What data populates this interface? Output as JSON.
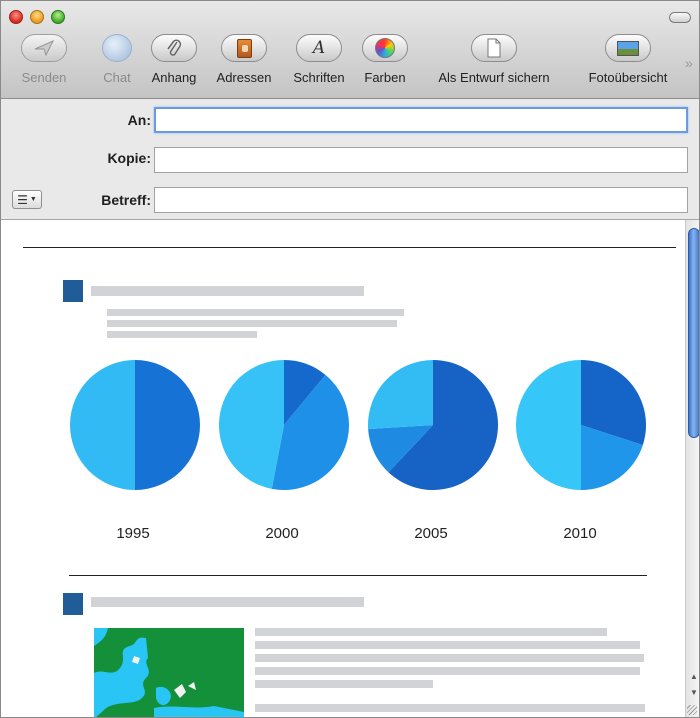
{
  "window": {
    "toolbar": [
      {
        "id": "senden",
        "label": "Senden",
        "icon": "send-icon",
        "enabled": false
      },
      {
        "id": "chat",
        "label": "Chat",
        "icon": "chat-bubble-icon",
        "enabled": false
      },
      {
        "id": "anhang",
        "label": "Anhang",
        "icon": "paperclip-icon",
        "enabled": true
      },
      {
        "id": "adressen",
        "label": "Adressen",
        "icon": "address-book-icon",
        "enabled": true
      },
      {
        "id": "schriften",
        "label": "Schriften",
        "icon": "font-icon",
        "enabled": true
      },
      {
        "id": "farben",
        "label": "Farben",
        "icon": "color-wheel-icon",
        "enabled": true
      },
      {
        "id": "entwurf",
        "label": "Als Entwurf sichern",
        "icon": "draft-document-icon",
        "enabled": true
      },
      {
        "id": "foto",
        "label": "Fotoübersicht",
        "icon": "photo-browser-icon",
        "enabled": true
      }
    ]
  },
  "headers": {
    "to_label": "An:",
    "to_value": "",
    "cc_label": "Kopie:",
    "cc_value": "",
    "subject_label": "Betreff:",
    "subject_value": "",
    "options_icon": "list-options-icon"
  },
  "chart_data": {
    "type": "pie",
    "charts": [
      {
        "label": "1995",
        "values": [
          50,
          50
        ],
        "colors": [
          "#1672d4",
          "#31baf3"
        ]
      },
      {
        "label": "2000",
        "values": [
          11,
          42,
          47
        ],
        "colors": [
          "#1569cc",
          "#1e90e8",
          "#36c2f7"
        ]
      },
      {
        "label": "2005",
        "values": [
          62,
          12,
          26
        ],
        "colors": [
          "#1662c5",
          "#1f8ae2",
          "#33bcf4"
        ]
      },
      {
        "label": "2010",
        "values": [
          30,
          20,
          50
        ],
        "colors": [
          "#1565c9",
          "#1f96ea",
          "#36c6f8"
        ]
      }
    ]
  },
  "colors": {
    "accent": "#1f5c98",
    "map_sea": "#29c6f5",
    "map_land": "#14903a"
  }
}
